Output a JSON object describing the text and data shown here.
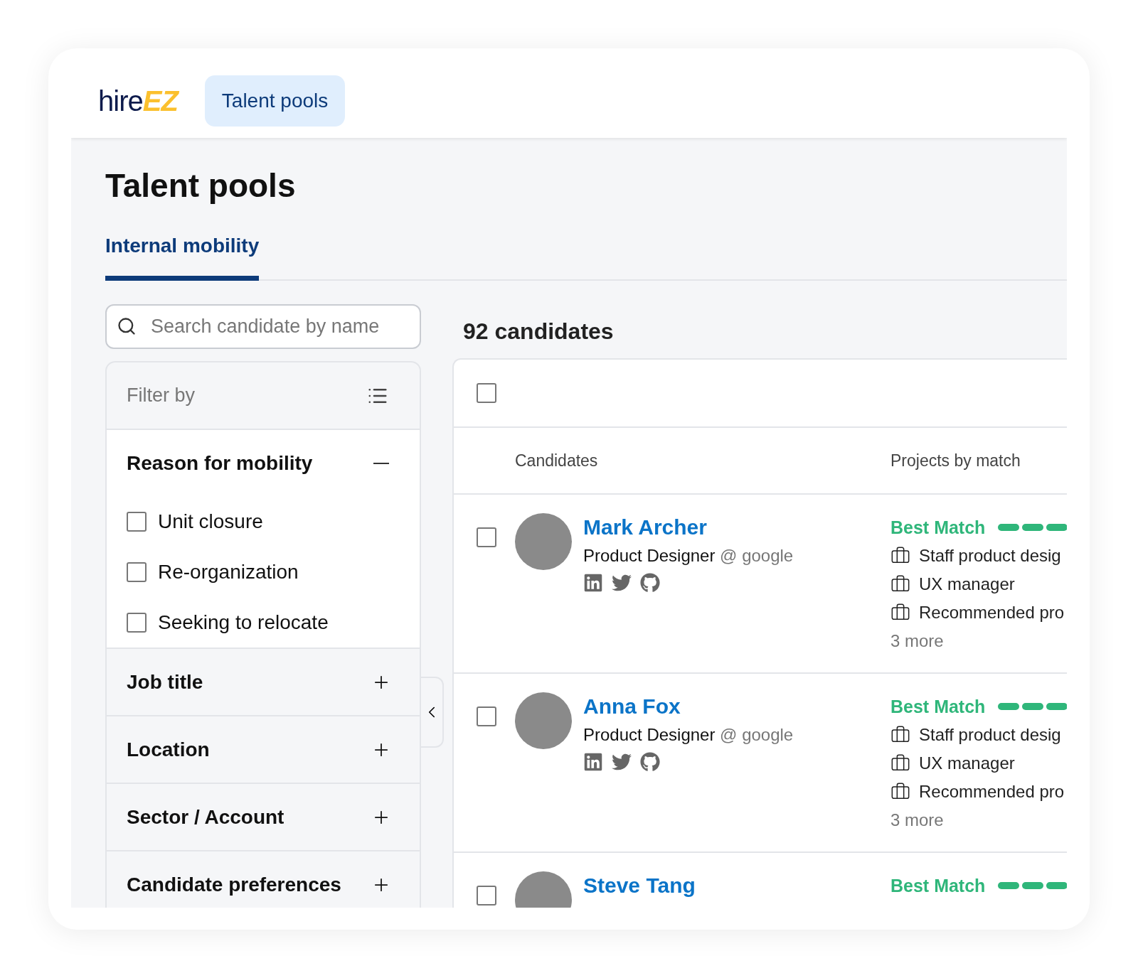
{
  "header": {
    "logo": {
      "part_1": "hire",
      "part_2": "EZ"
    },
    "nav_button": {
      "label": "Talent pools",
      "selected": true
    }
  },
  "page_title": "Talent pools",
  "tabs": [
    {
      "label": "Internal mobility",
      "selected": true
    }
  ],
  "search": {
    "placeholder": "Search candidate by name"
  },
  "filters": {
    "title": "Filter by",
    "sections": [
      {
        "title": "Reason for mobility",
        "expanded": true,
        "options": [
          {
            "label": "Unit closure",
            "checked": false
          },
          {
            "label": "Re-organization",
            "checked": false
          },
          {
            "label": "Seeking to relocate",
            "checked": false
          }
        ]
      },
      {
        "title": "Job title",
        "expanded": false
      },
      {
        "title": "Location",
        "expanded": false
      },
      {
        "title": "Sector / Account",
        "expanded": false
      },
      {
        "title": "Candidate preferences",
        "expanded": false
      }
    ]
  },
  "results": {
    "count": "92 candidates",
    "select_all_checked": false,
    "columns": [
      "Candidates",
      "Projects by match"
    ],
    "rows": [
      {
        "name": "Mark Archer",
        "checked": false,
        "title": "Product Designer",
        "company": "@ google",
        "match": "Best Match",
        "projects": [
          "Staff product desig",
          "UX manager",
          "Recommended pro"
        ],
        "more": "3 more"
      },
      {
        "name": "Anna Fox",
        "checked": false,
        "title": "Product Designer",
        "company": "@ google",
        "match": "Best Match",
        "projects": [
          "Staff product desig",
          "UX manager",
          "Recommended pro"
        ],
        "more": "3 more"
      },
      {
        "name": "Steve Tang",
        "checked": false,
        "match": "Best Match"
      }
    ]
  }
}
